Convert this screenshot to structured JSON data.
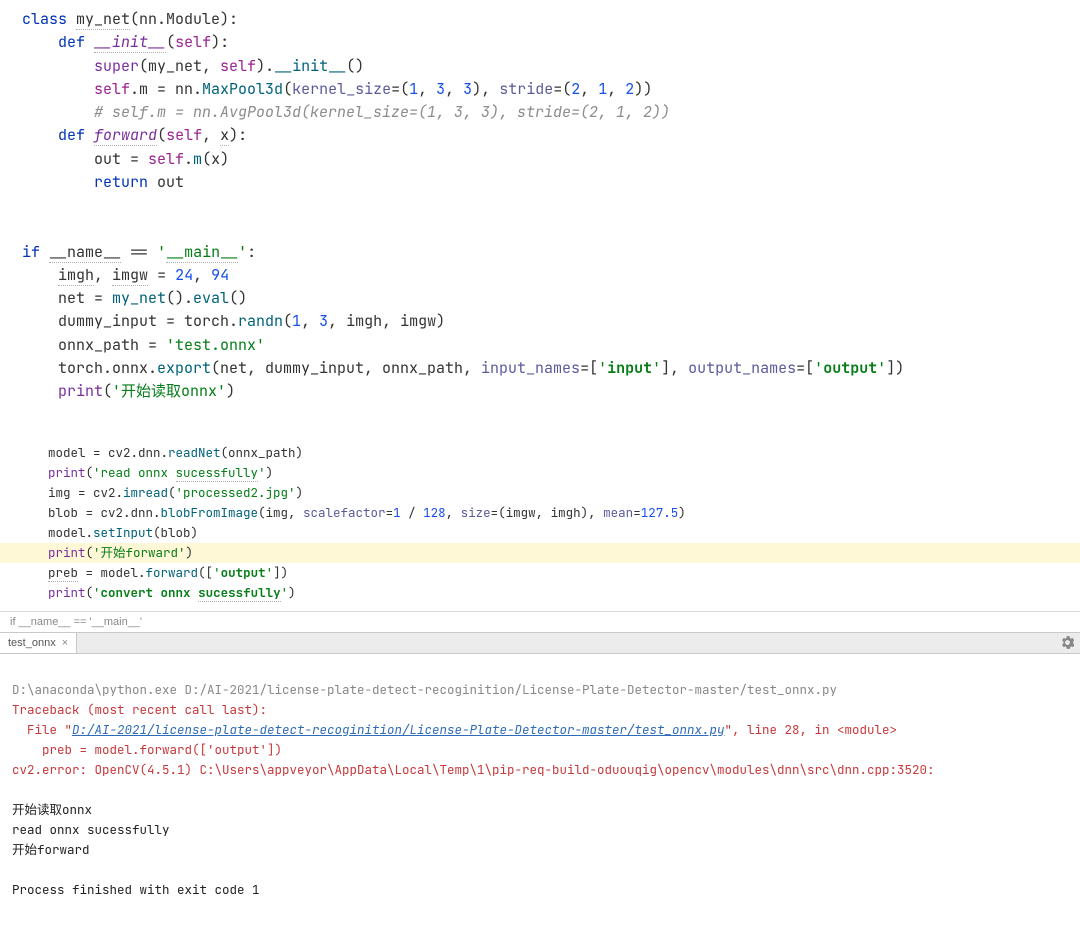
{
  "code_main": {
    "l1": "class my_net(nn.Module):",
    "l2": "    def __init__(self):",
    "l3": "        super(my_net, self).__init__()",
    "l4": "        self.m = nn.MaxPool3d(kernel_size=(1, 3, 3), stride=(2, 1, 2))",
    "l5": "        # self.m = nn.AvgPool3d(kernel_size=(1, 3, 3), stride=(2, 1, 2))",
    "l6": "    def forward(self, x):",
    "l7": "        out = self.m(x)",
    "l8": "        return out",
    "l9": "",
    "l10": "if __name__ == '__main__':",
    "l11": "    imgh, imgw = 24, 94",
    "l12": "    net = my_net().eval()",
    "l13": "    dummy_input = torch.randn(1, 3, imgh, imgw)",
    "l14": "    onnx_path = 'test.onnx'",
    "l15": "    torch.onnx.export(net, dummy_input, onnx_path, input_names=['input'], output_names=['output'])",
    "l16": "    print('开始读取onnx')"
  },
  "code_second": {
    "s1": "model = cv2.dnn.readNet(onnx_path)",
    "s2": "print('read onnx sucessfully')",
    "s3": "img = cv2.imread('processed2.jpg')",
    "s4": "blob = cv2.dnn.blobFromImage(img, scalefactor=1 / 128, size=(imgw, imgh), mean=127.5)",
    "s5": "model.setInput(blob)",
    "s6": "print('开始forward')",
    "s7": "preb = model.forward(['output'])",
    "s8": "print('convert onnx sucessfully')"
  },
  "breadcrumb": "if __name__ == '__main__'",
  "tab": {
    "label": "test_onnx",
    "close": "×"
  },
  "console": {
    "cmd": "D:\\anaconda\\python.exe D:/AI-2021/license-plate-detect-recoginition/License-Plate-Detector-master/test_onnx.py",
    "trace_hdr": "Traceback (most recent call last):",
    "file_pre": "  File \"",
    "file_link": "D:/AI-2021/license-plate-detect-recoginition/License-Plate-Detector-master/test_onnx.py",
    "file_post": "\", line 28, in <module>",
    "code_line": "    preb = model.forward(['output'])",
    "error": "cv2.error: OpenCV(4.5.1) C:\\Users\\appveyor\\AppData\\Local\\Temp\\1\\pip-req-build-oduouqig\\opencv\\modules\\dnn\\src\\dnn.cpp:3520:",
    "o1": "开始读取onnx",
    "o2": "read onnx sucessfully",
    "o3": "开始forward",
    "exit": "Process finished with exit code 1"
  }
}
